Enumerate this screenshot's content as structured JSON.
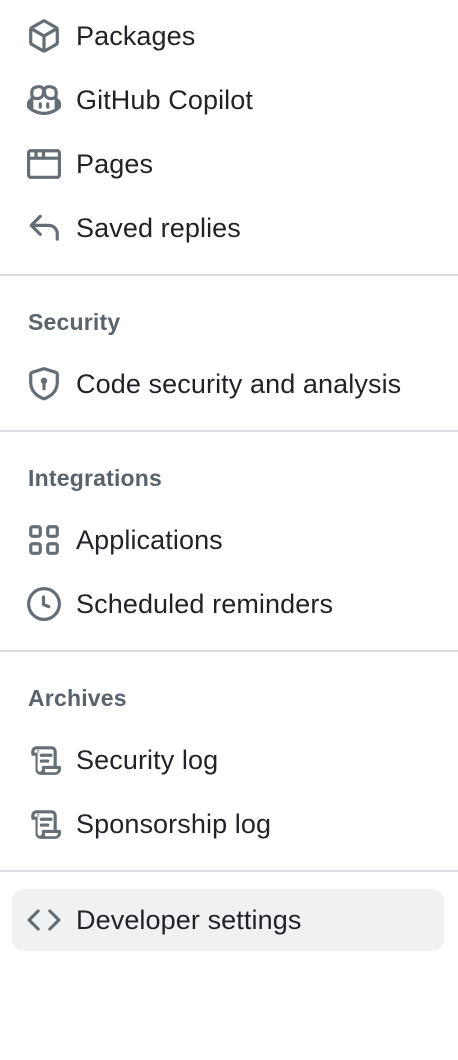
{
  "nav": {
    "top_items": [
      {
        "label": "Packages",
        "icon": "package-icon"
      },
      {
        "label": "GitHub Copilot",
        "icon": "copilot-icon"
      },
      {
        "label": "Pages",
        "icon": "browser-icon"
      },
      {
        "label": "Saved replies",
        "icon": "reply-icon"
      }
    ],
    "security": {
      "heading": "Security",
      "items": [
        {
          "label": "Code security and analysis",
          "icon": "shield-lock-icon"
        }
      ]
    },
    "integrations": {
      "heading": "Integrations",
      "items": [
        {
          "label": "Applications",
          "icon": "apps-icon"
        },
        {
          "label": "Scheduled reminders",
          "icon": "clock-icon"
        }
      ]
    },
    "archives": {
      "heading": "Archives",
      "items": [
        {
          "label": "Security log",
          "icon": "log-icon"
        },
        {
          "label": "Sponsorship log",
          "icon": "log-icon"
        }
      ]
    },
    "developer": {
      "label": "Developer settings",
      "icon": "code-icon",
      "selected": true
    }
  },
  "colors": {
    "icon": "#656d76",
    "text": "#1f2328",
    "heading": "#59636e",
    "divider": "#d8dee4",
    "selected_bg": "#f0f1f3"
  }
}
